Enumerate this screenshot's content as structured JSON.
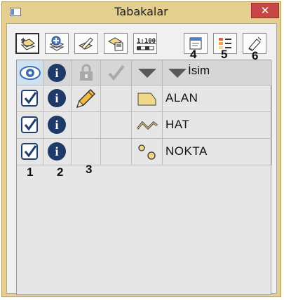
{
  "window": {
    "title": "Tabakalar",
    "close_label": "✕"
  },
  "toolbar": {
    "buttons": [
      {
        "icon": "add-layer-icon"
      },
      {
        "icon": "add-data-icon"
      },
      {
        "icon": "edit-layer-icon"
      },
      {
        "icon": "save-layer-icon"
      },
      {
        "icon": "scale-icon",
        "label": "1:100"
      },
      {
        "icon": "layer-properties-icon"
      },
      {
        "icon": "legend-icon"
      },
      {
        "icon": "clear-icon"
      }
    ]
  },
  "table": {
    "header": {
      "name_label": "İsim"
    },
    "rows": [
      {
        "name": "ALAN",
        "symbol": "polygon-icon",
        "visible": true,
        "info": "i",
        "editable": true
      },
      {
        "name": "HAT",
        "symbol": "line-icon",
        "visible": true,
        "info": "i",
        "editable": false
      },
      {
        "name": "NOKTA",
        "symbol": "point-icon",
        "visible": true,
        "info": "i",
        "editable": false
      }
    ]
  },
  "callouts": [
    "1",
    "2",
    "3",
    "4",
    "5",
    "6"
  ],
  "colors": {
    "title_bar": "#e4cf90",
    "close_button": "#c74745",
    "info_icon": "#1f3a68",
    "polygon_fill": "#f4d88a",
    "point_fill": "#f4d88a"
  }
}
